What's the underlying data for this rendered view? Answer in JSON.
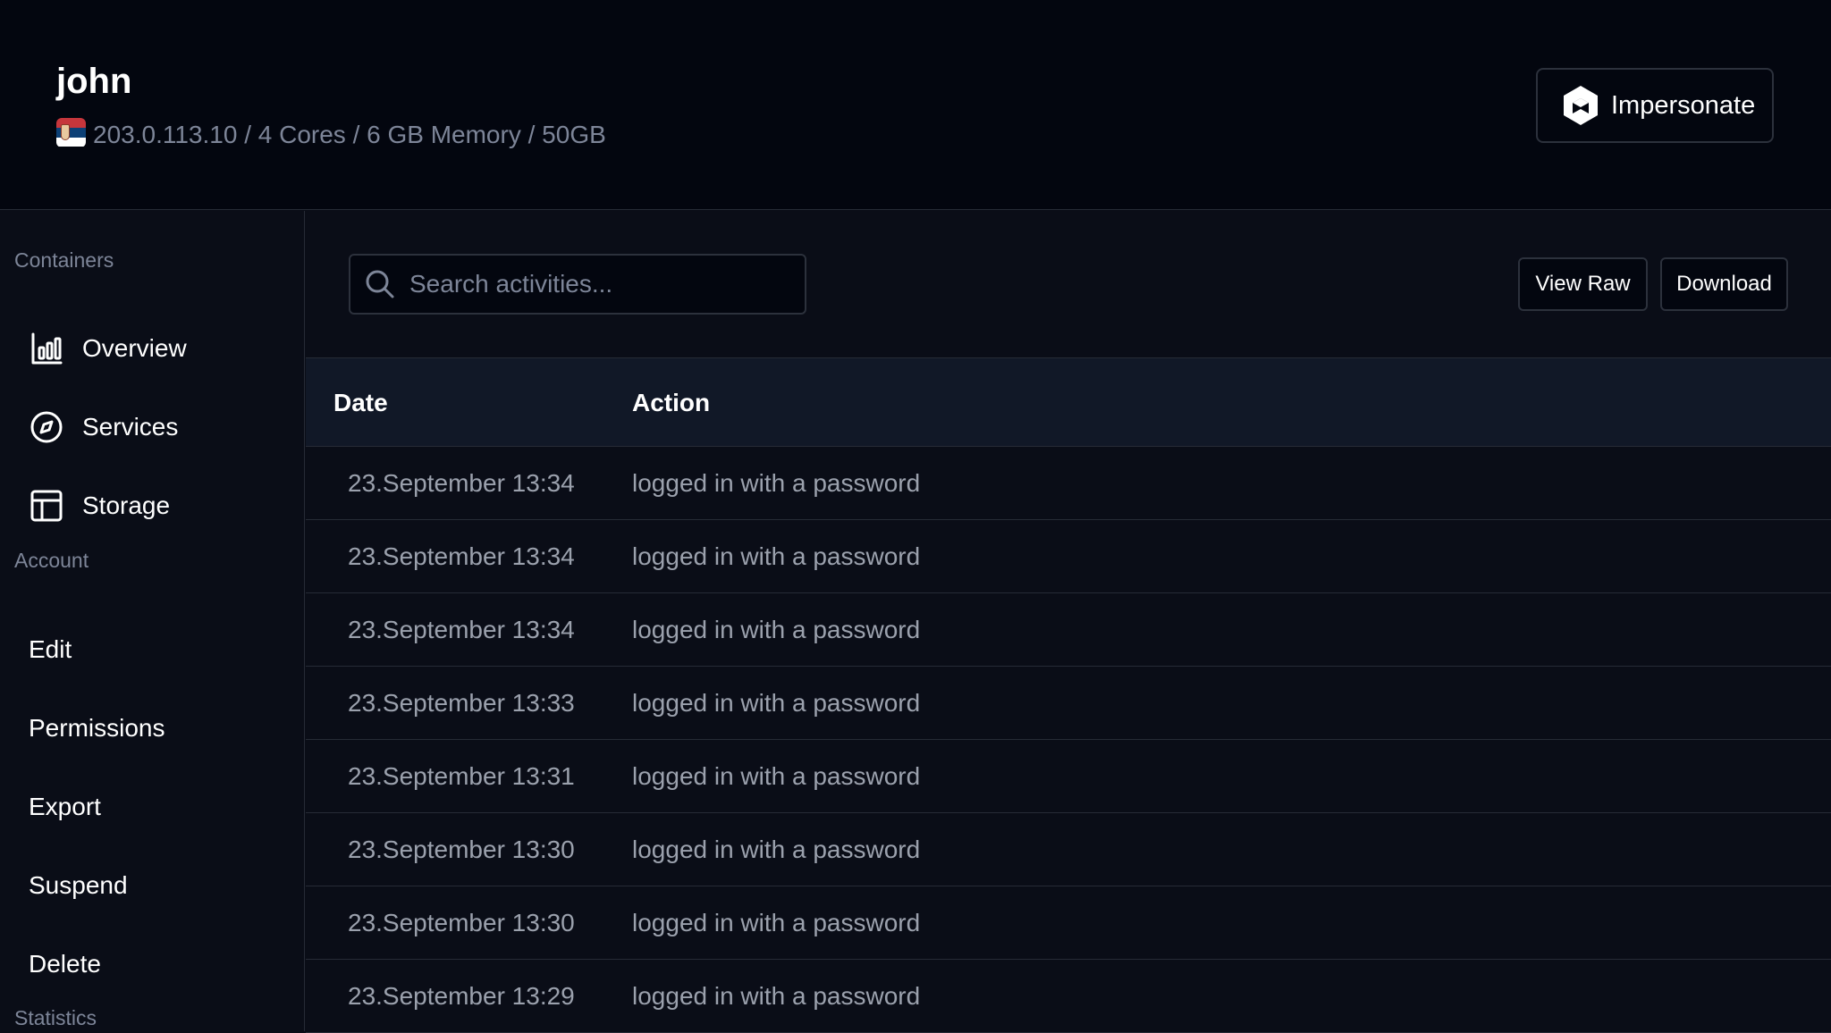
{
  "header": {
    "title": "john",
    "specs": "203.0.113.10 / 4 Cores / 6 GB Memory / 50GB",
    "flag_icon": "serbia-flag-icon",
    "impersonate_label": "Impersonate"
  },
  "sidebar": {
    "sections": {
      "containers": "Containers",
      "account": "Account",
      "statistics": "Statistics"
    },
    "container_items": [
      {
        "label": "Overview",
        "icon": "bar-chart-icon"
      },
      {
        "label": "Services",
        "icon": "compass-icon"
      },
      {
        "label": "Storage",
        "icon": "layout-icon"
      }
    ],
    "account_items": [
      {
        "label": "Edit"
      },
      {
        "label": "Permissions"
      },
      {
        "label": "Export"
      },
      {
        "label": "Suspend"
      },
      {
        "label": "Delete"
      }
    ]
  },
  "toolbar": {
    "search_placeholder": "Search activities...",
    "search_value": "",
    "view_raw_label": "View Raw",
    "download_label": "Download"
  },
  "table": {
    "columns": [
      "Date",
      "Action"
    ],
    "rows": [
      {
        "date": "23.September 13:34",
        "action": "logged in with a password"
      },
      {
        "date": "23.September 13:34",
        "action": "logged in with a password"
      },
      {
        "date": "23.September 13:34",
        "action": "logged in with a password"
      },
      {
        "date": "23.September 13:33",
        "action": "logged in with a password"
      },
      {
        "date": "23.September 13:31",
        "action": "logged in with a password"
      },
      {
        "date": "23.September 13:30",
        "action": "logged in with a password"
      },
      {
        "date": "23.September 13:30",
        "action": "logged in with a password"
      },
      {
        "date": "23.September 13:29",
        "action": "logged in with a password"
      }
    ]
  },
  "colors": {
    "background": "#0a0d17",
    "header_background": "#03060f",
    "table_header_background": "#111827",
    "muted_text": "#7d8598",
    "border": "#262b36"
  }
}
